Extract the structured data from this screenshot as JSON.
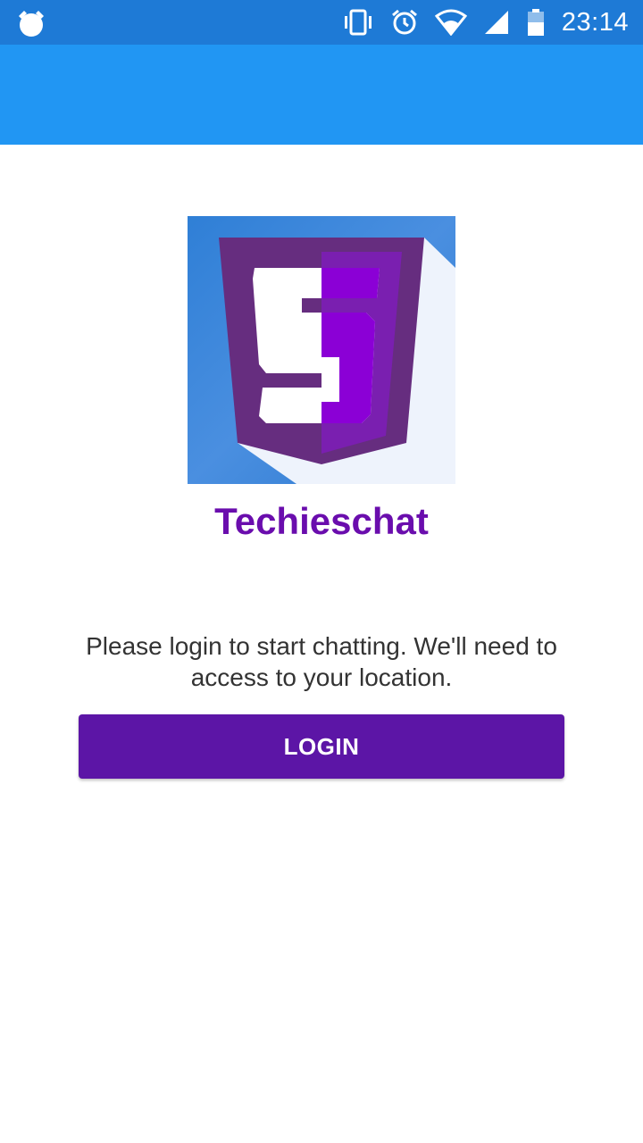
{
  "status_bar": {
    "time": "23:14",
    "icons": [
      "alarm-clock-icon",
      "vibrate-icon",
      "alarm-icon",
      "wifi-icon",
      "signal-icon",
      "battery-icon"
    ]
  },
  "app": {
    "name": "Techieschat",
    "logo_icon": "techieschat-logo",
    "logo_letter": "S"
  },
  "login": {
    "message": "Please login to start chatting. We'll need to access to your location.",
    "button_label": "LOGIN"
  },
  "colors": {
    "status_bar": "#1e7ad6",
    "app_bar": "#2196f3",
    "brand_purple": "#6a0dad",
    "button": "#5c15a6"
  }
}
